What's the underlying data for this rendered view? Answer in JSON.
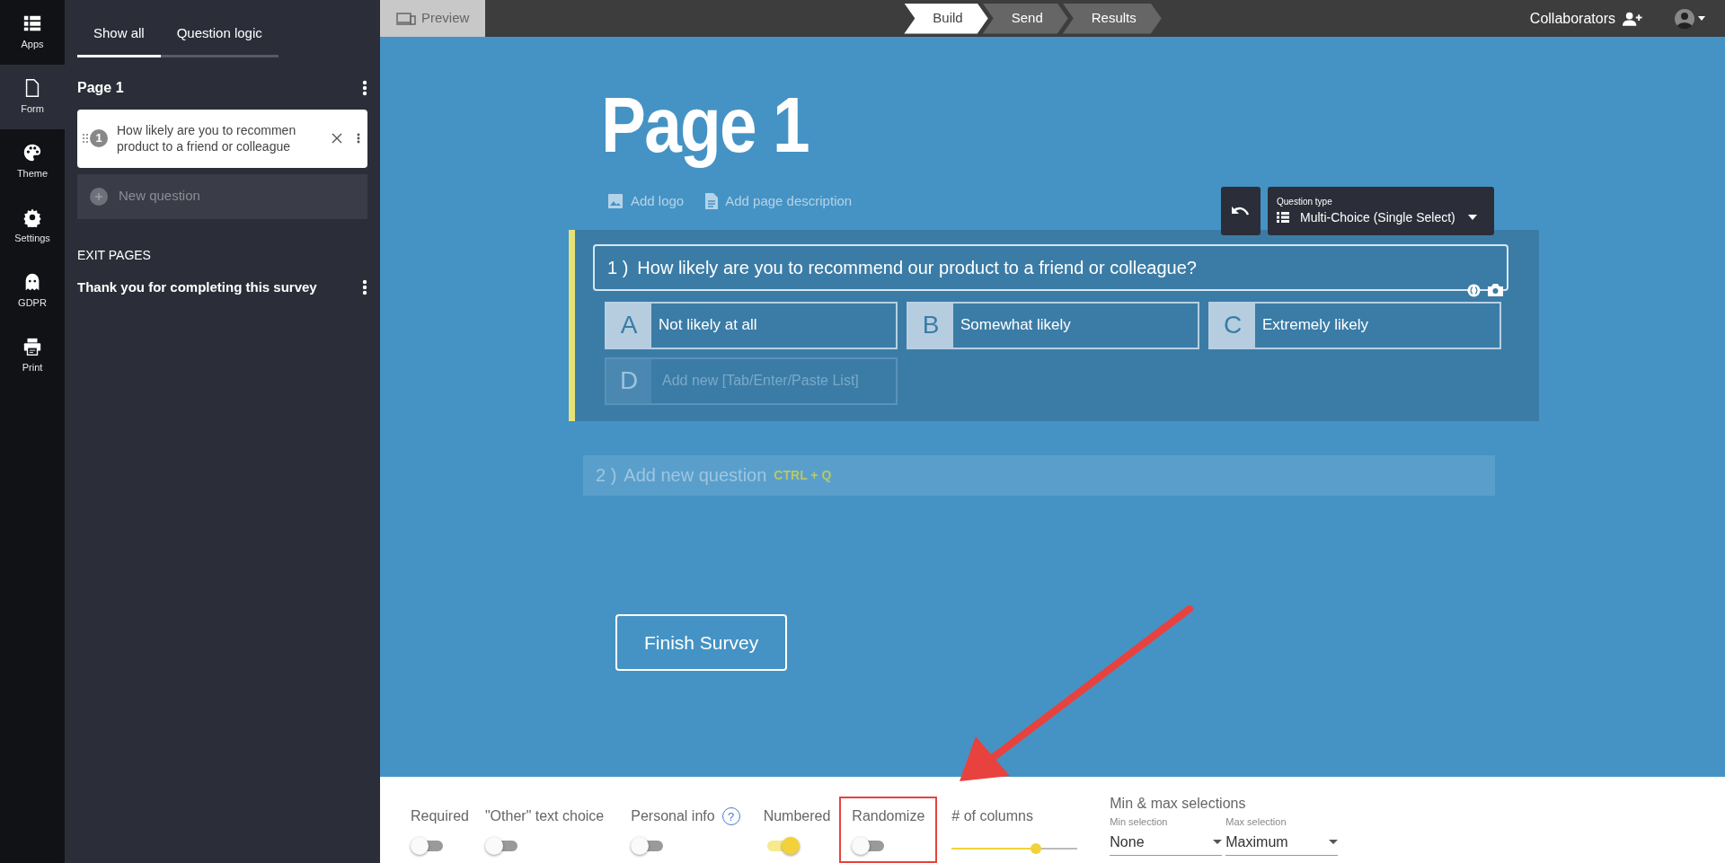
{
  "rail": [
    {
      "label": "Apps",
      "selected": false
    },
    {
      "label": "Form",
      "selected": true
    },
    {
      "label": "Theme",
      "selected": false
    },
    {
      "label": "Settings",
      "selected": false
    },
    {
      "label": "GDPR",
      "selected": false
    },
    {
      "label": "Print",
      "selected": false
    }
  ],
  "sidebar": {
    "tabs": [
      {
        "label": "Show all",
        "selected": true
      },
      {
        "label": "Question logic",
        "selected": false
      }
    ],
    "page_title": "Page 1",
    "questions": [
      {
        "number": "1",
        "text": "How likely are you to recommen",
        "text_2": "product to a friend or colleague"
      }
    ],
    "new_question": "New question",
    "exit_heading": "EXIT PAGES",
    "exit_pages": [
      "Thank you for completing this survey"
    ]
  },
  "topbar": {
    "preview": "Preview",
    "steps": [
      {
        "label": "Build",
        "selected": true
      },
      {
        "label": "Send",
        "selected": false
      },
      {
        "label": "Results",
        "selected": false
      }
    ],
    "collaborators": "Collaborators"
  },
  "main": {
    "title": "Page 1",
    "add_logo": "Add logo",
    "add_description": "Add page description",
    "question_type_label": "Question type",
    "question_type": "Multi-Choice (Single Select)",
    "question": {
      "number": "1 )",
      "text": "How likely are you to recommend our product to a friend or colleague?"
    },
    "options": [
      {
        "letter": "A",
        "text": "Not likely at all",
        "kind": "option"
      },
      {
        "letter": "B",
        "text": "Somewhat likely",
        "kind": "option"
      },
      {
        "letter": "C",
        "text": "Extremely likely",
        "kind": "option"
      },
      {
        "letter": "D",
        "placeholder": "Add new [Tab/Enter/Paste List]",
        "kind": "new"
      }
    ],
    "add_question": {
      "number": "2 )",
      "text": "Add new question",
      "shortcut": "CTRL + Q"
    },
    "finish": "Finish Survey"
  },
  "bottom": {
    "toggles": [
      {
        "label": "Required",
        "on": false
      },
      {
        "label": "\"Other\" text choice",
        "on": false
      },
      {
        "label": "Personal info",
        "on": false,
        "help": "?"
      },
      {
        "label": "Numbered",
        "on": true
      },
      {
        "label": "Randomize",
        "on": false,
        "highlighted": true
      }
    ],
    "columns": {
      "label": "# of columns",
      "level": 0.67
    },
    "selections": {
      "title": "Min & max selections",
      "min_label": "Min selection",
      "min_value": "None",
      "max_label": "Max selection",
      "max_value": "Maximum"
    }
  }
}
